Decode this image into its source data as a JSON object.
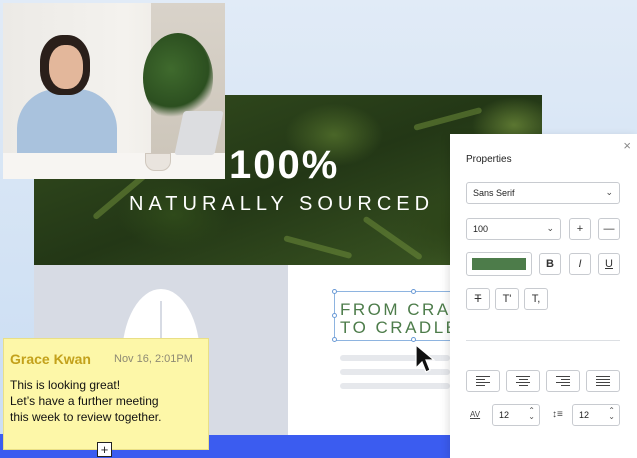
{
  "hero": {
    "headline": "100%",
    "subheadline": "NATURALLY SOURCED"
  },
  "slogan": {
    "text": "FROM CRADLE\nTO CRADLE"
  },
  "properties": {
    "title": "Properties",
    "font_family": "Sans Serif",
    "font_size": "100",
    "increase_label": "+",
    "decrease_label": "—",
    "color": "#4d7c4a",
    "bold_label": "B",
    "italic_label": "I",
    "underline_label": "U",
    "strike_label": "T",
    "superscript_label": "T'",
    "subscript_label": "T,",
    "letter_spacing": "12",
    "line_spacing": "12",
    "letter_spacing_icon": "AV",
    "line_spacing_icon": "↕≡"
  },
  "note": {
    "author": "Grace Kwan",
    "timestamp": "Nov 16, 2:01PM",
    "message": "This is looking great!\nLet’s have a further meeting\nthis week to review together."
  },
  "icons": {
    "close": "×",
    "chevron": "⌄",
    "add": "+"
  }
}
